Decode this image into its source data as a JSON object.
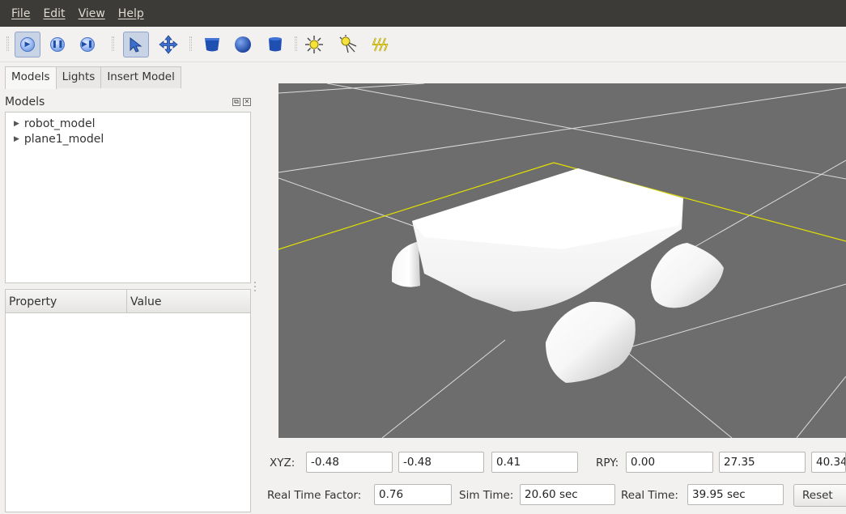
{
  "menubar": {
    "items": [
      "File",
      "Edit",
      "View",
      "Help"
    ]
  },
  "toolbar": {
    "icons": [
      "play-icon",
      "pause-icon",
      "step-icon",
      "select-arrow-icon",
      "translate-icon",
      "box-icon",
      "sphere-icon",
      "cylinder-icon",
      "point-light-icon",
      "spot-light-icon",
      "directional-light-icon"
    ]
  },
  "tabs": [
    "Models",
    "Lights",
    "Insert Model"
  ],
  "models_panel": {
    "title": "Models",
    "items": [
      "robot_model",
      "plane1_model"
    ]
  },
  "property_table": {
    "columns": [
      "Property",
      "Value"
    ]
  },
  "pose": {
    "xyz_label": "XYZ:",
    "x": "-0.48",
    "y": "-0.48",
    "z": "0.41",
    "rpy_label": "RPY:",
    "roll": "0.00",
    "pitch": "27.35",
    "yaw": "40.34"
  },
  "stats": {
    "rtf_label": "Real Time Factor:",
    "rtf": "0.76",
    "sim_label": "Sim Time:",
    "sim": "20.60 sec",
    "real_label": "Real Time:",
    "real": "39.95 sec",
    "reset_label": "Reset"
  },
  "colors": {
    "ground": "#6d6d6d",
    "grid": "#d8d8d8",
    "highlight": "#e2e000",
    "menubar": "#3c3b37"
  }
}
